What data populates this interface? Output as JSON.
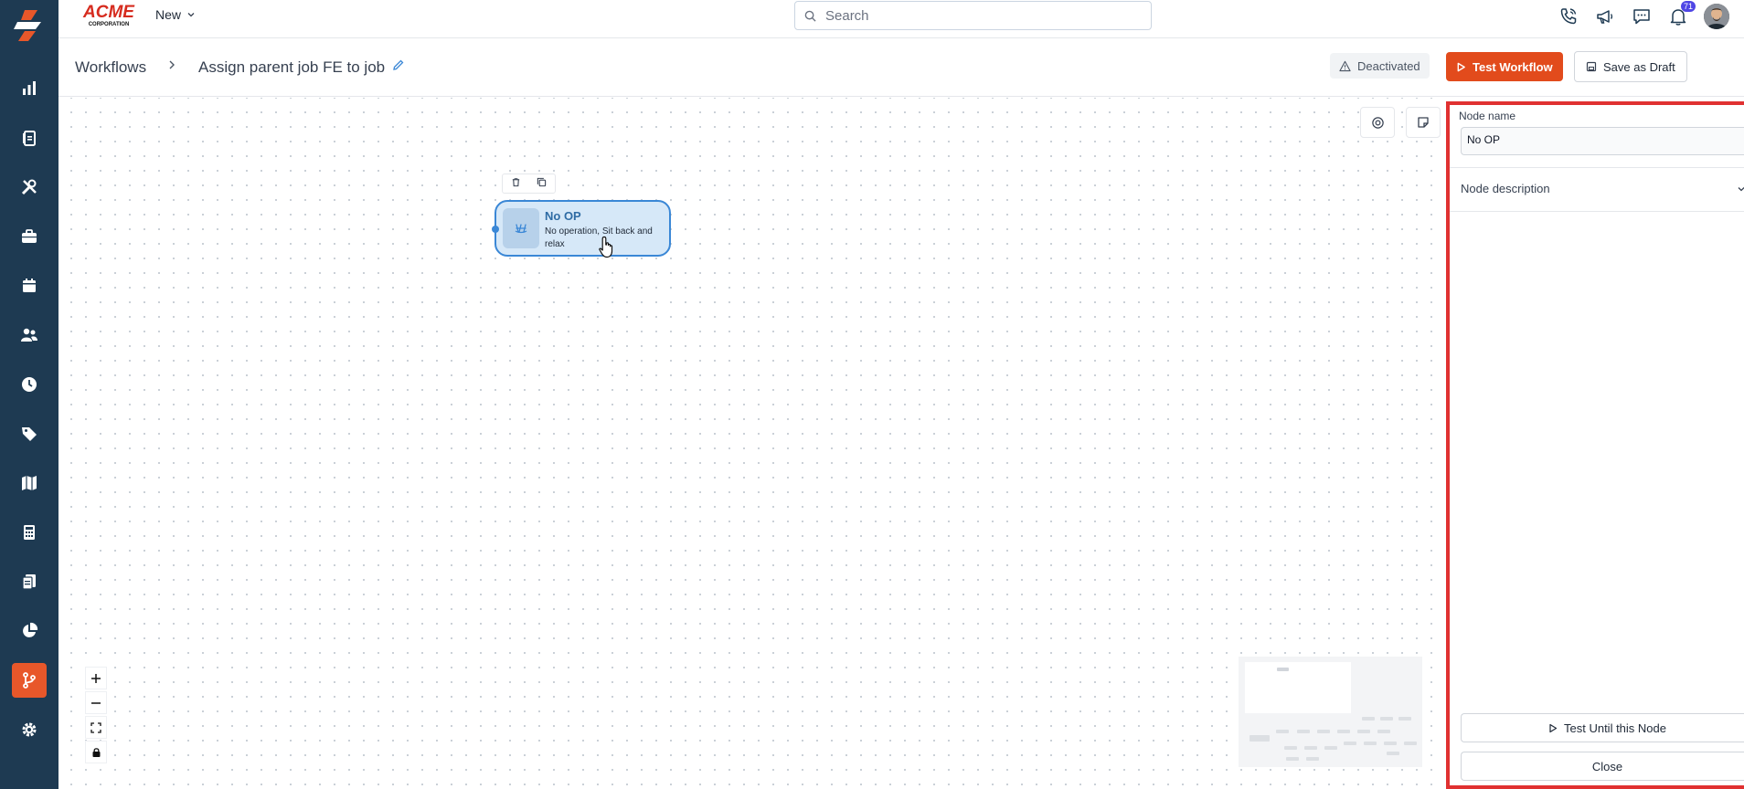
{
  "app": {
    "brand_logo": "ACME CORPORATION",
    "new_label": "New",
    "search_placeholder": "Search",
    "notification_count": "71"
  },
  "colors": {
    "sidebar_bg": "#1e3a52",
    "accent": "#e24b1c",
    "node_border": "#3a87d6",
    "panel_highlight": "#e03131"
  },
  "sidebar": {
    "items": [
      {
        "icon": "bar-chart-icon",
        "active": false
      },
      {
        "icon": "clipboard-icon",
        "active": false
      },
      {
        "icon": "tools-icon",
        "active": false
      },
      {
        "icon": "briefcase-icon",
        "active": false
      },
      {
        "icon": "calendar-icon",
        "active": false
      },
      {
        "icon": "users-icon",
        "active": false
      },
      {
        "icon": "clock-icon",
        "active": false
      },
      {
        "icon": "tag-icon",
        "active": false
      },
      {
        "icon": "map-icon",
        "active": false
      },
      {
        "icon": "calculator-icon",
        "active": false
      },
      {
        "icon": "documents-icon",
        "active": false
      },
      {
        "icon": "pie-chart-icon",
        "active": false
      },
      {
        "icon": "workflow-icon",
        "active": true
      },
      {
        "icon": "gear-icon",
        "active": false
      }
    ]
  },
  "header": {
    "breadcrumb_root": "Workflows",
    "title": "Assign parent job FE to job",
    "status": "Deactivated",
    "test_workflow": "Test Workflow",
    "save_draft": "Save as Draft"
  },
  "canvas": {
    "node": {
      "title": "No OP",
      "description": "No operation, Sit back and relax"
    }
  },
  "panel": {
    "node_name_label": "Node name",
    "node_name_value": "No OP",
    "node_description_label": "Node description",
    "test_until_node": "Test Until this Node",
    "close": "Close"
  }
}
